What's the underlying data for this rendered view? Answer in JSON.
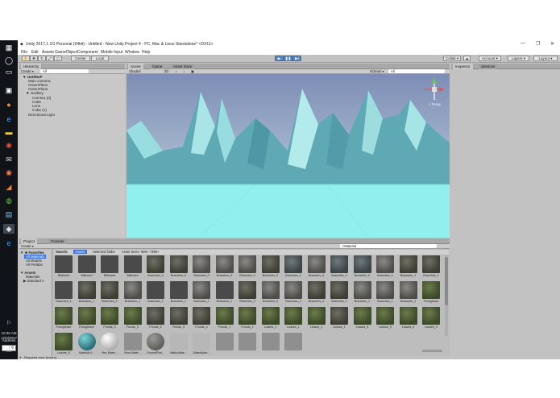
{
  "window": {
    "title": "Unity 2017.1.1f1 Personal (64bit) - Untitled - New Unity Project 4 - PC, Mac & Linux Standalone* <DX11>",
    "menu": [
      "File",
      "Edit",
      "Assets",
      "GameObject",
      "Component",
      "Mobile Input",
      "Window",
      "Help"
    ],
    "controls": {
      "minimize": "—",
      "maximize": "❐",
      "close": "✕"
    }
  },
  "toolbar": {
    "pivot_label": "Center",
    "space_label": "Local",
    "collab_label": "Collab ▾",
    "account_label": "Account ▾",
    "layers_label": "Layers ▾",
    "layout_label": "Layout ▾"
  },
  "hierarchy": {
    "tab": "Hierarchy",
    "create_label": "Create ▾",
    "search_placeholder": "All",
    "items": [
      {
        "label": "▼ Untitled*"
      },
      {
        "label": "Main Camera"
      },
      {
        "label": "GreenPlane"
      },
      {
        "label": "GreenPlane"
      },
      {
        "label": "▼ Godlery"
      },
      {
        "label": "Camera (0)"
      },
      {
        "label": "Cube"
      },
      {
        "label": "Lens"
      },
      {
        "label": "Cube (1)"
      },
      {
        "label": "Directional Light"
      }
    ]
  },
  "scene": {
    "tabs": [
      "Scene",
      "Game",
      "Asset Store"
    ],
    "shading_label": "Shaded",
    "mode_label": "2D",
    "gizmos_label": "Gizmos ▾",
    "search_placeholder": "All",
    "persp_label": "< Persp",
    "colors": {
      "sky_top": "#7f8fb8",
      "sky_bottom": "#c6d6df",
      "ground": "#8ff0ee",
      "mountain": "#5fa9b4"
    }
  },
  "inspector": {
    "tabs": [
      "Inspector",
      "Services"
    ]
  },
  "project": {
    "tabs": [
      "Project",
      "Console"
    ],
    "create_label": "Create ▾",
    "search_label": "Search:",
    "search_scope": [
      "Assets",
      "Selected folder",
      "Asset Store: 999+ / 999+"
    ],
    "search_value": "t:Material",
    "favorites": {
      "header": "▼ ★ Favorites",
      "items": [
        {
          "label": "All Materials",
          "selected": true
        },
        {
          "label": "All Models",
          "selected": false
        },
        {
          "label": "All Prefabs",
          "selected": false
        }
      ]
    },
    "assets_tree": {
      "header": "▼ Assets",
      "items": [
        "Materials",
        "▶ Standard A"
      ]
    },
    "assets": [
      {
        "label": "Billboard",
        "kind": "dark"
      },
      {
        "label": "Billboard",
        "kind": "dark"
      },
      {
        "label": "Billboard",
        "kind": "dark"
      },
      {
        "label": "Billboard",
        "kind": "dark"
      },
      {
        "label": "Branches_0",
        "kind": "leafy"
      },
      {
        "label": "Branches_0",
        "kind": "leafy"
      },
      {
        "label": "Branches_0",
        "kind": "rock"
      },
      {
        "label": "Branches_0",
        "kind": "rock"
      },
      {
        "label": "Branches_0",
        "kind": "rock"
      },
      {
        "label": "Branches_0",
        "kind": "leafy"
      },
      {
        "label": "Branches_0",
        "kind": "bark"
      },
      {
        "label": "Branches_0",
        "kind": "rock"
      },
      {
        "label": "Branches_0",
        "kind": "bark"
      },
      {
        "label": "Branches_0",
        "kind": "bark"
      },
      {
        "label": "Branches_1",
        "kind": "rock"
      },
      {
        "label": "Branches_1",
        "kind": "leafy"
      },
      {
        "label": "Branches_1",
        "kind": "leafy"
      },
      {
        "label": "Branches_1",
        "kind": "dark"
      },
      {
        "label": "Branches_1",
        "kind": "leafy"
      },
      {
        "label": "Branches_1",
        "kind": "leafy"
      },
      {
        "label": "Branches_1",
        "kind": "rock"
      },
      {
        "label": "Branches_1",
        "kind": "dark"
      },
      {
        "label": "Branches_1",
        "kind": "dark"
      },
      {
        "label": "Branches_1",
        "kind": "rock"
      },
      {
        "label": "Branches_1",
        "kind": "dark"
      },
      {
        "label": "Branches_2",
        "kind": "leafy"
      },
      {
        "label": "Branches_2",
        "kind": "rock"
      },
      {
        "label": "Branches_2",
        "kind": "rock"
      },
      {
        "label": "Branches_2",
        "kind": "leafy"
      },
      {
        "label": "Branches_1",
        "kind": "leafy"
      },
      {
        "label": "Branches_1",
        "kind": "rock"
      },
      {
        "label": "Branches_1",
        "kind": "rock"
      },
      {
        "label": "Branches_1",
        "kind": "rock"
      },
      {
        "label": "Foringleave",
        "kind": "green"
      },
      {
        "label": "Foringleave",
        "kind": "green"
      },
      {
        "label": "Foringleave",
        "kind": "green"
      },
      {
        "label": "Fronds_0",
        "kind": "green"
      },
      {
        "label": "Fronds_0",
        "kind": "green"
      },
      {
        "label": "Fronds_0",
        "kind": "leafy"
      },
      {
        "label": "Fronds_0",
        "kind": "leafy"
      },
      {
        "label": "Fronds_0",
        "kind": "leafy"
      },
      {
        "label": "Fronds_1",
        "kind": "green"
      },
      {
        "label": "Fronds_1",
        "kind": "green"
      },
      {
        "label": "Leaves_1",
        "kind": "green"
      },
      {
        "label": "Leaves_1",
        "kind": "green"
      },
      {
        "label": "Leaves_1",
        "kind": "green"
      },
      {
        "label": "Leaves_1",
        "kind": "leafy"
      },
      {
        "label": "Leaves_0",
        "kind": "green"
      },
      {
        "label": "Leaves_0",
        "kind": "green"
      },
      {
        "label": "Leaves_0",
        "kind": "green"
      },
      {
        "label": "Leaves_0",
        "kind": "green"
      },
      {
        "label": "Leaves_0",
        "kind": "green"
      },
      {
        "label": "Material-0...",
        "kind": "teal"
      },
      {
        "label": "Hex Mater...",
        "kind": "white"
      },
      {
        "label": "New Mater...",
        "kind": "grey"
      },
      {
        "label": "GroundPlan...",
        "kind": "stone"
      },
      {
        "label": "WaterAdde...",
        "kind": "lightgrey"
      },
      {
        "label": "WaterAdde...",
        "kind": "lightgrey"
      },
      {
        "label": "",
        "kind": "grey"
      },
      {
        "label": "",
        "kind": "grey"
      },
      {
        "label": "",
        "kind": "grey"
      },
      {
        "label": "",
        "kind": "grey"
      }
    ]
  },
  "status": {
    "message": "Required error (errors)"
  },
  "taskbar": {
    "time": "10:36 AM",
    "date": "12/2/2017",
    "address_label": "Address",
    "address_value": "↑ 6",
    "icons": [
      "windows-icon",
      "circle-icon",
      "taskview-icon",
      "edge-icon",
      "store-icon",
      "settings-icon",
      "chrome-icon",
      "unity-icon",
      "explorer-icon",
      "mail-icon",
      "chrome-alt-icon"
    ]
  }
}
